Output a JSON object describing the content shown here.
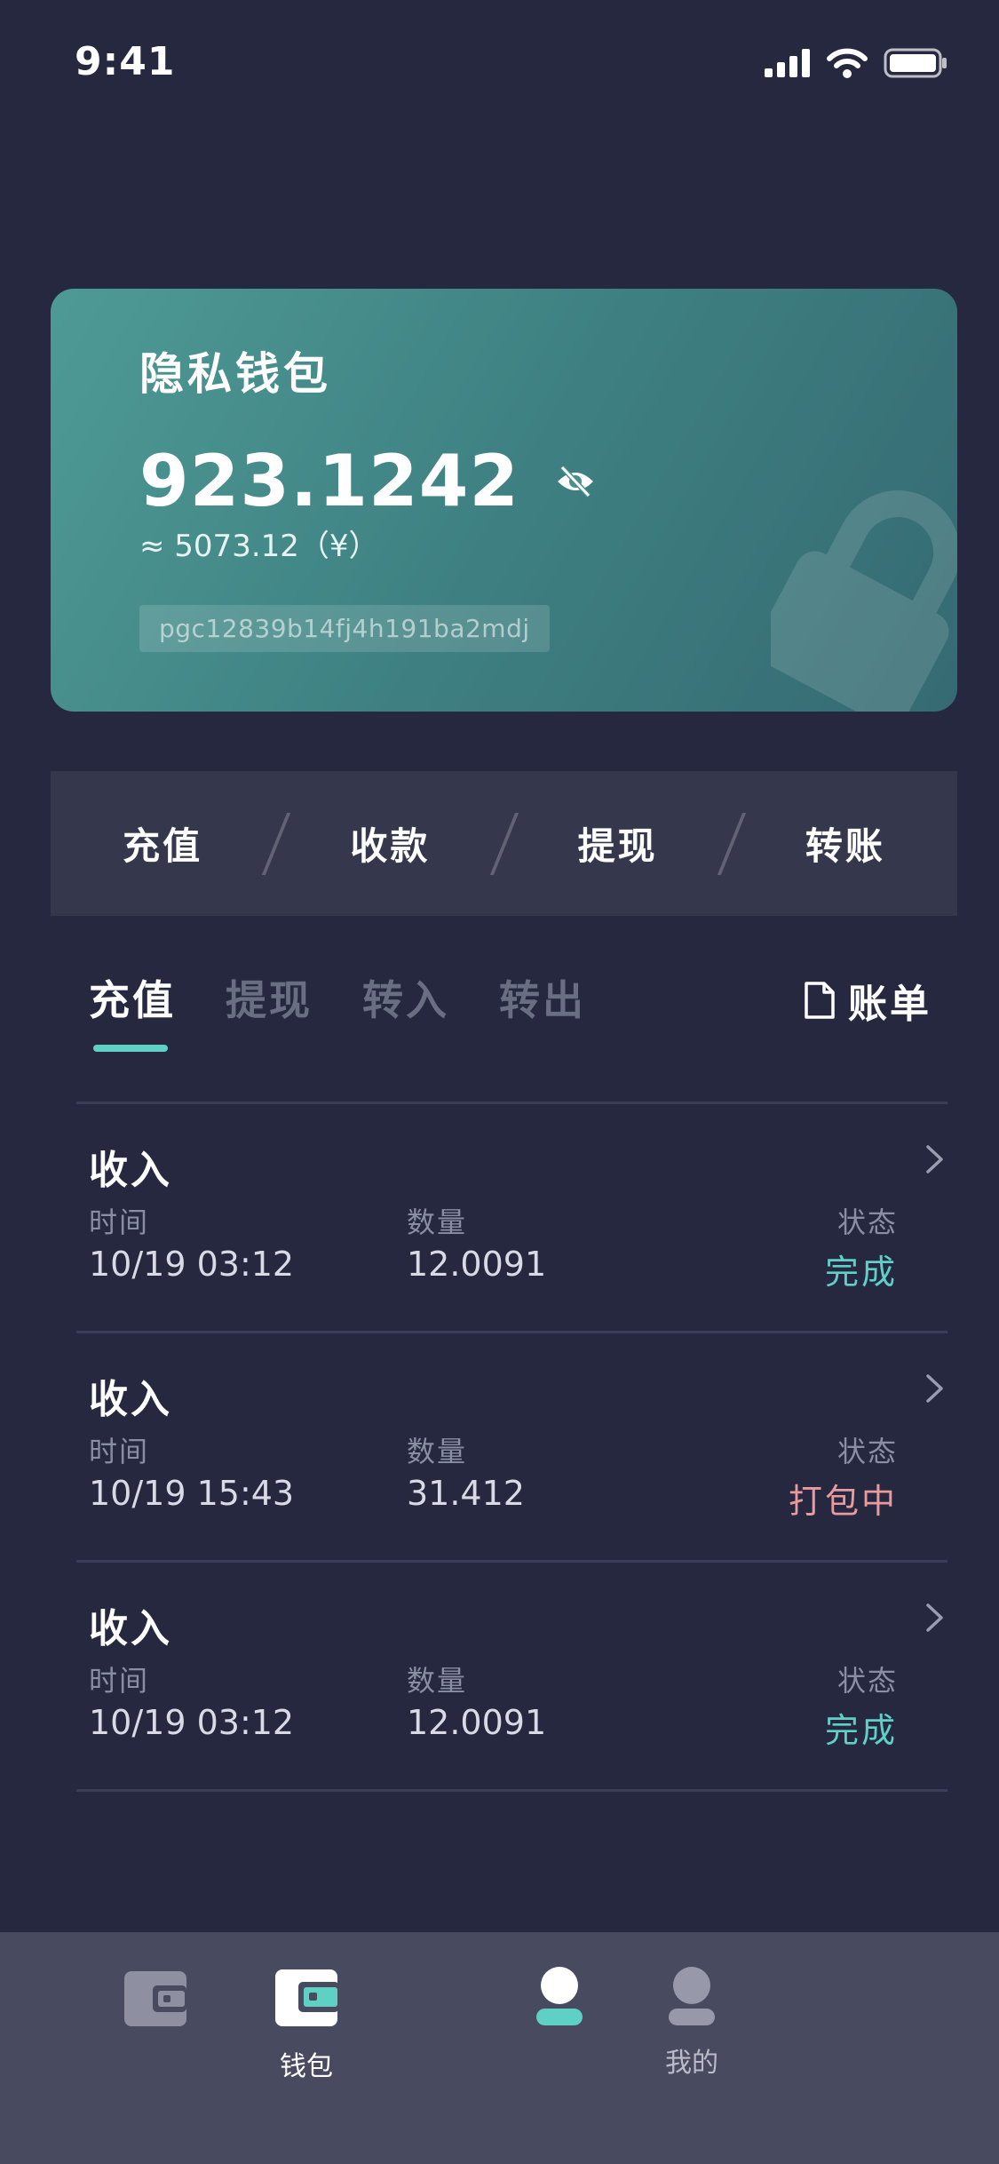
{
  "status_bar": {
    "time": "9:41"
  },
  "wallet": {
    "title": "隐私钱包",
    "balance": "923.1242",
    "approx": "≈ 5073.12（¥）",
    "address": "pgc12839b14fj4h191ba2mdj"
  },
  "actions": [
    "充值",
    "收款",
    "提现",
    "转账"
  ],
  "tabs": [
    {
      "label": "充值",
      "active": true
    },
    {
      "label": "提现",
      "active": false
    },
    {
      "label": "转入",
      "active": false
    },
    {
      "label": "转出",
      "active": false
    }
  ],
  "bill_label": "账单",
  "records": [
    {
      "type": "收入",
      "time_label": "时间",
      "time": "10/19 03:12",
      "amount_label": "数量",
      "amount": "12.0091",
      "status_label": "状态",
      "status": "完成"
    },
    {
      "type": "收入",
      "time_label": "时间",
      "time": "10/19 15:43",
      "amount_label": "数量",
      "amount": "31.412",
      "status_label": "状态",
      "status": "打包中"
    },
    {
      "type": "收入",
      "time_label": "时间",
      "time": "10/19 03:12",
      "amount_label": "数量",
      "amount": "12.0091",
      "status_label": "状态",
      "status": "完成"
    }
  ],
  "bottom_nav": [
    {
      "label": "",
      "icon": "wallet-icon",
      "active": false
    },
    {
      "label": "钱包",
      "icon": "wallet-icon",
      "active": true
    },
    {
      "label": "",
      "icon": "user-icon",
      "active": true
    },
    {
      "label": "我的",
      "icon": "user-icon",
      "active": false
    }
  ],
  "colors": {
    "background": "#262840",
    "card_start": "#4e9a96",
    "card_end": "#356a72",
    "accent": "#5fd1c4",
    "pending": "#e99a9f",
    "nav_bg": "#484b60"
  }
}
